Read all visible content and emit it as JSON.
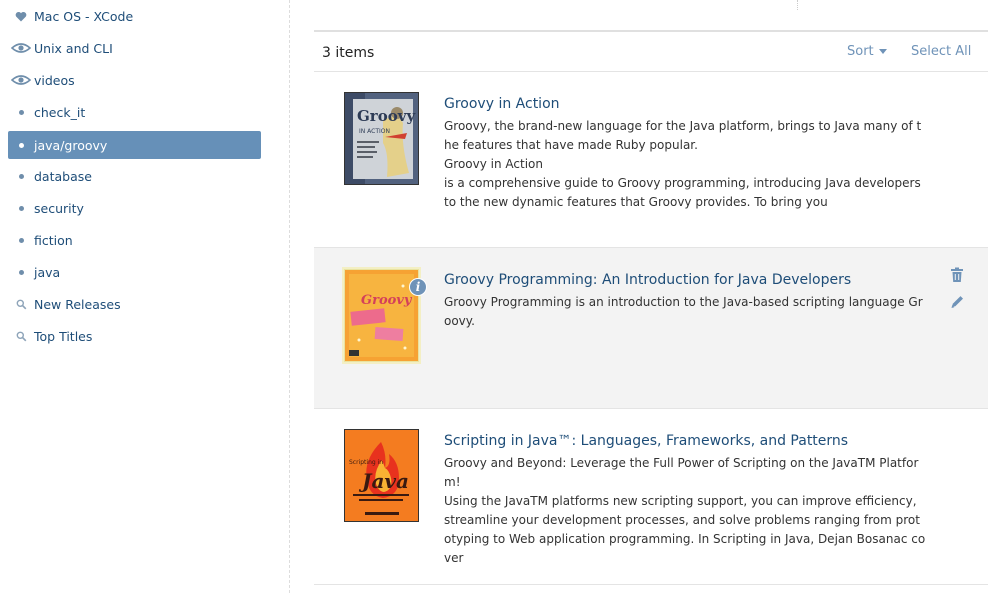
{
  "sidebar": {
    "items": [
      {
        "label": "Mac OS - XCode",
        "icon": "heart-icon"
      },
      {
        "label": "Unix and CLI",
        "icon": "eye-icon"
      },
      {
        "label": "videos",
        "icon": "eye-icon"
      },
      {
        "label": "check_it",
        "icon": "bullet-icon"
      },
      {
        "label": "java/groovy",
        "icon": "bullet-icon",
        "active": true
      },
      {
        "label": "database",
        "icon": "bullet-icon"
      },
      {
        "label": "security",
        "icon": "bullet-icon"
      },
      {
        "label": "fiction",
        "icon": "bullet-icon"
      },
      {
        "label": "java",
        "icon": "bullet-icon"
      },
      {
        "label": "New Releases",
        "icon": "search-icon"
      },
      {
        "label": "Top Titles",
        "icon": "search-icon"
      }
    ]
  },
  "toolbar": {
    "count_label": "3 items",
    "sort_label": "Sort",
    "select_all_label": "Select All"
  },
  "books": [
    {
      "title": "Groovy in Action",
      "description": "Groovy, the brand-new language for the Java platform, brings to Java many of the features that have made Ruby popular.\nGroovy in Action\nis a comprehensive guide to Groovy programming, introducing Java developers to the new dynamic features that Groovy provides. To bring you",
      "cover_text": "Groovy",
      "cover_subtext": "IN ACTION"
    },
    {
      "title": "Groovy Programming: An Introduction for Java Developers",
      "description": "Groovy Programming is an introduction to the Java-based scripting language Groovy.",
      "cover_text": "Groovy"
    },
    {
      "title": "Scripting in Java™: Languages, Frameworks, and Patterns",
      "description": "Groovy and Beyond: Leverage the Full Power of Scripting on the JavaTM Platform!\nUsing the JavaTM platforms new scripting support, you can improve efficiency, streamline your development processes, and solve problems ranging from prototyping to Web application programming. In Scripting in Java, Dejan Bosanac cover",
      "cover_text": "Java",
      "cover_subtext": "Scripting in"
    }
  ],
  "colors": {
    "accent": "#6690b8",
    "link": "#1e4d78",
    "muted_link": "#6f93b8"
  }
}
